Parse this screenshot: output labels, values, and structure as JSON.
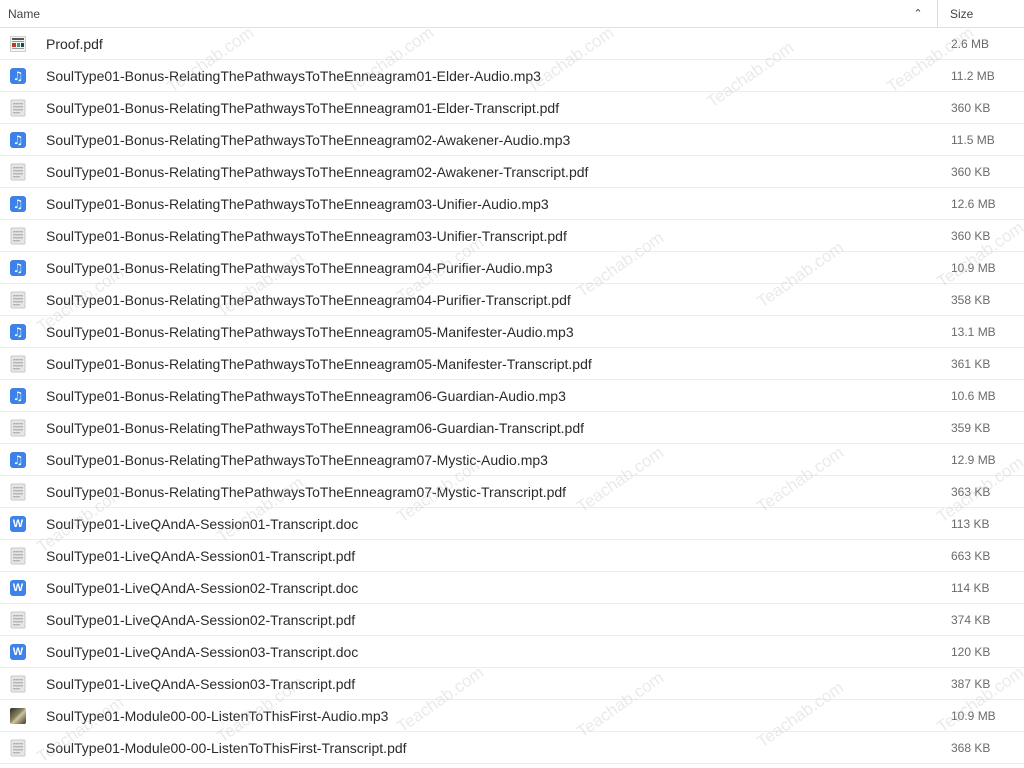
{
  "header": {
    "name_label": "Name",
    "size_label": "Size"
  },
  "files": [
    {
      "name": "Proof.pdf",
      "size": "2.6 MB",
      "icon": "proof-thumbnail-icon"
    },
    {
      "name": "SoulType01-Bonus-RelatingThePathwaysToTheEnneagram01-Elder-Audio.mp3",
      "size": "11.2 MB",
      "icon": "audio-file-icon"
    },
    {
      "name": "SoulType01-Bonus-RelatingThePathwaysToTheEnneagram01-Elder-Transcript.pdf",
      "size": "360 KB",
      "icon": "pdf-file-icon"
    },
    {
      "name": "SoulType01-Bonus-RelatingThePathwaysToTheEnneagram02-Awakener-Audio.mp3",
      "size": "11.5 MB",
      "icon": "audio-file-icon"
    },
    {
      "name": "SoulType01-Bonus-RelatingThePathwaysToTheEnneagram02-Awakener-Transcript.pdf",
      "size": "360 KB",
      "icon": "pdf-file-icon"
    },
    {
      "name": "SoulType01-Bonus-RelatingThePathwaysToTheEnneagram03-Unifier-Audio.mp3",
      "size": "12.6 MB",
      "icon": "audio-file-icon"
    },
    {
      "name": "SoulType01-Bonus-RelatingThePathwaysToTheEnneagram03-Unifier-Transcript.pdf",
      "size": "360 KB",
      "icon": "pdf-file-icon"
    },
    {
      "name": "SoulType01-Bonus-RelatingThePathwaysToTheEnneagram04-Purifier-Audio.mp3",
      "size": "10.9 MB",
      "icon": "audio-file-icon"
    },
    {
      "name": "SoulType01-Bonus-RelatingThePathwaysToTheEnneagram04-Purifier-Transcript.pdf",
      "size": "358 KB",
      "icon": "pdf-file-icon"
    },
    {
      "name": "SoulType01-Bonus-RelatingThePathwaysToTheEnneagram05-Manifester-Audio.mp3",
      "size": "13.1 MB",
      "icon": "audio-file-icon"
    },
    {
      "name": "SoulType01-Bonus-RelatingThePathwaysToTheEnneagram05-Manifester-Transcript.pdf",
      "size": "361 KB",
      "icon": "pdf-file-icon"
    },
    {
      "name": "SoulType01-Bonus-RelatingThePathwaysToTheEnneagram06-Guardian-Audio.mp3",
      "size": "10.6 MB",
      "icon": "audio-file-icon"
    },
    {
      "name": "SoulType01-Bonus-RelatingThePathwaysToTheEnneagram06-Guardian-Transcript.pdf",
      "size": "359 KB",
      "icon": "pdf-file-icon"
    },
    {
      "name": "SoulType01-Bonus-RelatingThePathwaysToTheEnneagram07-Mystic-Audio.mp3",
      "size": "12.9 MB",
      "icon": "audio-file-icon"
    },
    {
      "name": "SoulType01-Bonus-RelatingThePathwaysToTheEnneagram07-Mystic-Transcript.pdf",
      "size": "363 KB",
      "icon": "pdf-file-icon"
    },
    {
      "name": "SoulType01-LiveQAndA-Session01-Transcript.doc",
      "size": "113 KB",
      "icon": "word-file-icon"
    },
    {
      "name": "SoulType01-LiveQAndA-Session01-Transcript.pdf",
      "size": "663 KB",
      "icon": "pdf-file-icon"
    },
    {
      "name": "SoulType01-LiveQAndA-Session02-Transcript.doc",
      "size": "114 KB",
      "icon": "word-file-icon"
    },
    {
      "name": "SoulType01-LiveQAndA-Session02-Transcript.pdf",
      "size": "374 KB",
      "icon": "pdf-file-icon"
    },
    {
      "name": "SoulType01-LiveQAndA-Session03-Transcript.doc",
      "size": "120 KB",
      "icon": "word-file-icon"
    },
    {
      "name": "SoulType01-LiveQAndA-Session03-Transcript.pdf",
      "size": "387 KB",
      "icon": "pdf-file-icon"
    },
    {
      "name": "SoulType01-Module00-00-ListenToThisFirst-Audio.mp3",
      "size": "10.9 MB",
      "icon": "audio-thumbnail-icon"
    },
    {
      "name": "SoulType01-Module00-00-ListenToThisFirst-Transcript.pdf",
      "size": "368 KB",
      "icon": "pdf-file-icon"
    }
  ],
  "watermark_text": "Teachab.com",
  "colors": {
    "audio_icon": "#3d82e6",
    "word_icon": "#3d82e6",
    "row_border": "#ededed",
    "size_text": "#6b6b6b"
  }
}
